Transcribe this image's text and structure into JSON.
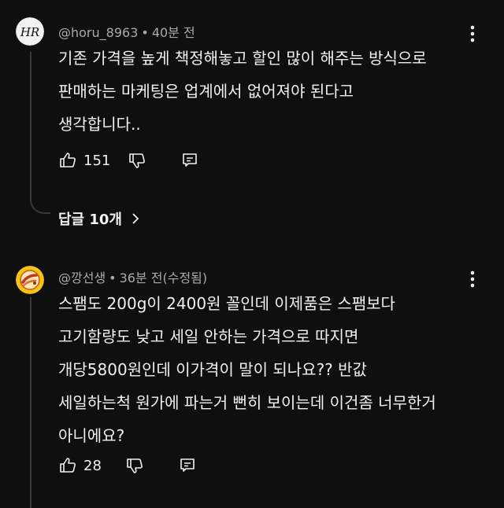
{
  "colors": {
    "background": "#0f0f0f",
    "text": "#f1f1f1",
    "meta": "#aaaaaa",
    "thread_line": "#3a3a3a"
  },
  "comments": [
    {
      "avatar": {
        "icon": "hr-monogram-avatar",
        "letters": "HR"
      },
      "author": "@horu_8963",
      "separator": "•",
      "time": "40분 전",
      "lines": [
        "기존 가격을 높게 책정해놓고 할인 많이 해주는 방식으로",
        "판매하는 마케팅은 업계에서 없어져야 된다고",
        "생각합니다.."
      ],
      "likes": "151",
      "icons": [
        "thumbs-up-icon",
        "thumbs-down-icon",
        "reply-icon",
        "more-vert-icon"
      ],
      "replies_label": "답글 10개"
    },
    {
      "avatar": {
        "icon": "food-illustration-avatar"
      },
      "author": "@깡선생",
      "separator": "•",
      "time": "36분 전(수정됨)",
      "lines": [
        "스팸도 200g이 2400원 꼴인데 이제품은 스팸보다",
        "고기함량도 낮고 세일 안하는 가격으로 따지면",
        "개당5800원인데 이가격이 말이 되나요?? 반값",
        "세일하는척 원가에 파는거 뻔히 보이는데 이건좀 너무한거",
        "아니에요?"
      ],
      "likes": "28",
      "icons": [
        "thumbs-up-icon",
        "thumbs-down-icon",
        "reply-icon",
        "more-vert-icon"
      ]
    }
  ]
}
